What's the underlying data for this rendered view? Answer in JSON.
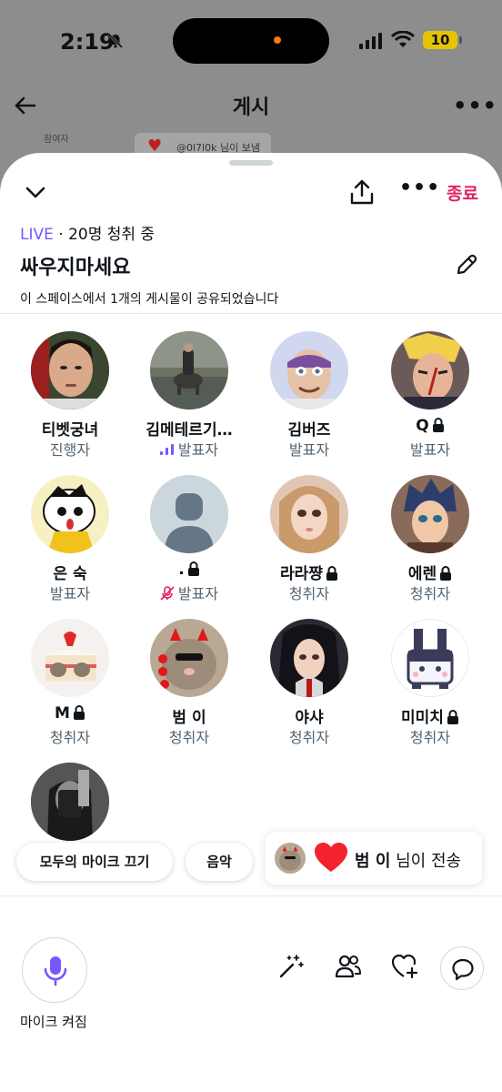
{
  "status_bar": {
    "time": "2:19",
    "battery": "10"
  },
  "background": {
    "title": "게시",
    "sub_label": "참여자",
    "chip_text": "@0l7l0k 님이 보냄"
  },
  "header": {
    "end_label": "종료"
  },
  "space": {
    "live_badge": "LIVE",
    "listener_text": " · 20명 청취 중",
    "title": "싸우지마세요",
    "shared_note": "이 스페이스에서 1개의 게시물이 공유되었습니다"
  },
  "participants": [
    {
      "name": "티벳궁녀",
      "role": "진행자",
      "lock": false,
      "role_icon": ""
    },
    {
      "name": "김메테르기…",
      "role": "발표자",
      "lock": false,
      "role_icon": "speaking-icon"
    },
    {
      "name": "김버즈",
      "role": "발표자",
      "lock": false,
      "role_icon": ""
    },
    {
      "name": "Q",
      "role": "발표자",
      "lock": true,
      "role_icon": ""
    },
    {
      "name": "은 숙",
      "role": "발표자",
      "lock": false,
      "role_icon": ""
    },
    {
      "name": ".",
      "role": "발표자",
      "lock": true,
      "role_icon": "mic-off-icon"
    },
    {
      "name": "라라쨩",
      "role": "청취자",
      "lock": true,
      "role_icon": ""
    },
    {
      "name": "에렌",
      "role": "청취자",
      "lock": true,
      "role_icon": ""
    },
    {
      "name": "M",
      "role": "청취자",
      "lock": true,
      "role_icon": ""
    },
    {
      "name": "범 이",
      "role": "청취자",
      "lock": false,
      "role_icon": ""
    },
    {
      "name": "야샤",
      "role": "청취자",
      "lock": false,
      "role_icon": ""
    },
    {
      "name": "미미치",
      "role": "청취자",
      "lock": true,
      "role_icon": ""
    },
    {
      "name": "",
      "role": "",
      "lock": false,
      "role_icon": ""
    }
  ],
  "actions": {
    "mute_all": "모두의 마이크 끄기",
    "music": "음악"
  },
  "reaction": {
    "sender": "범 이",
    "suffix": " 님이 전송"
  },
  "bottom": {
    "mic_label": "마이크 켜짐"
  },
  "colors": {
    "accent_purple": "#7856ff",
    "end_red": "#e0245e",
    "heart_red": "#f4212e"
  }
}
